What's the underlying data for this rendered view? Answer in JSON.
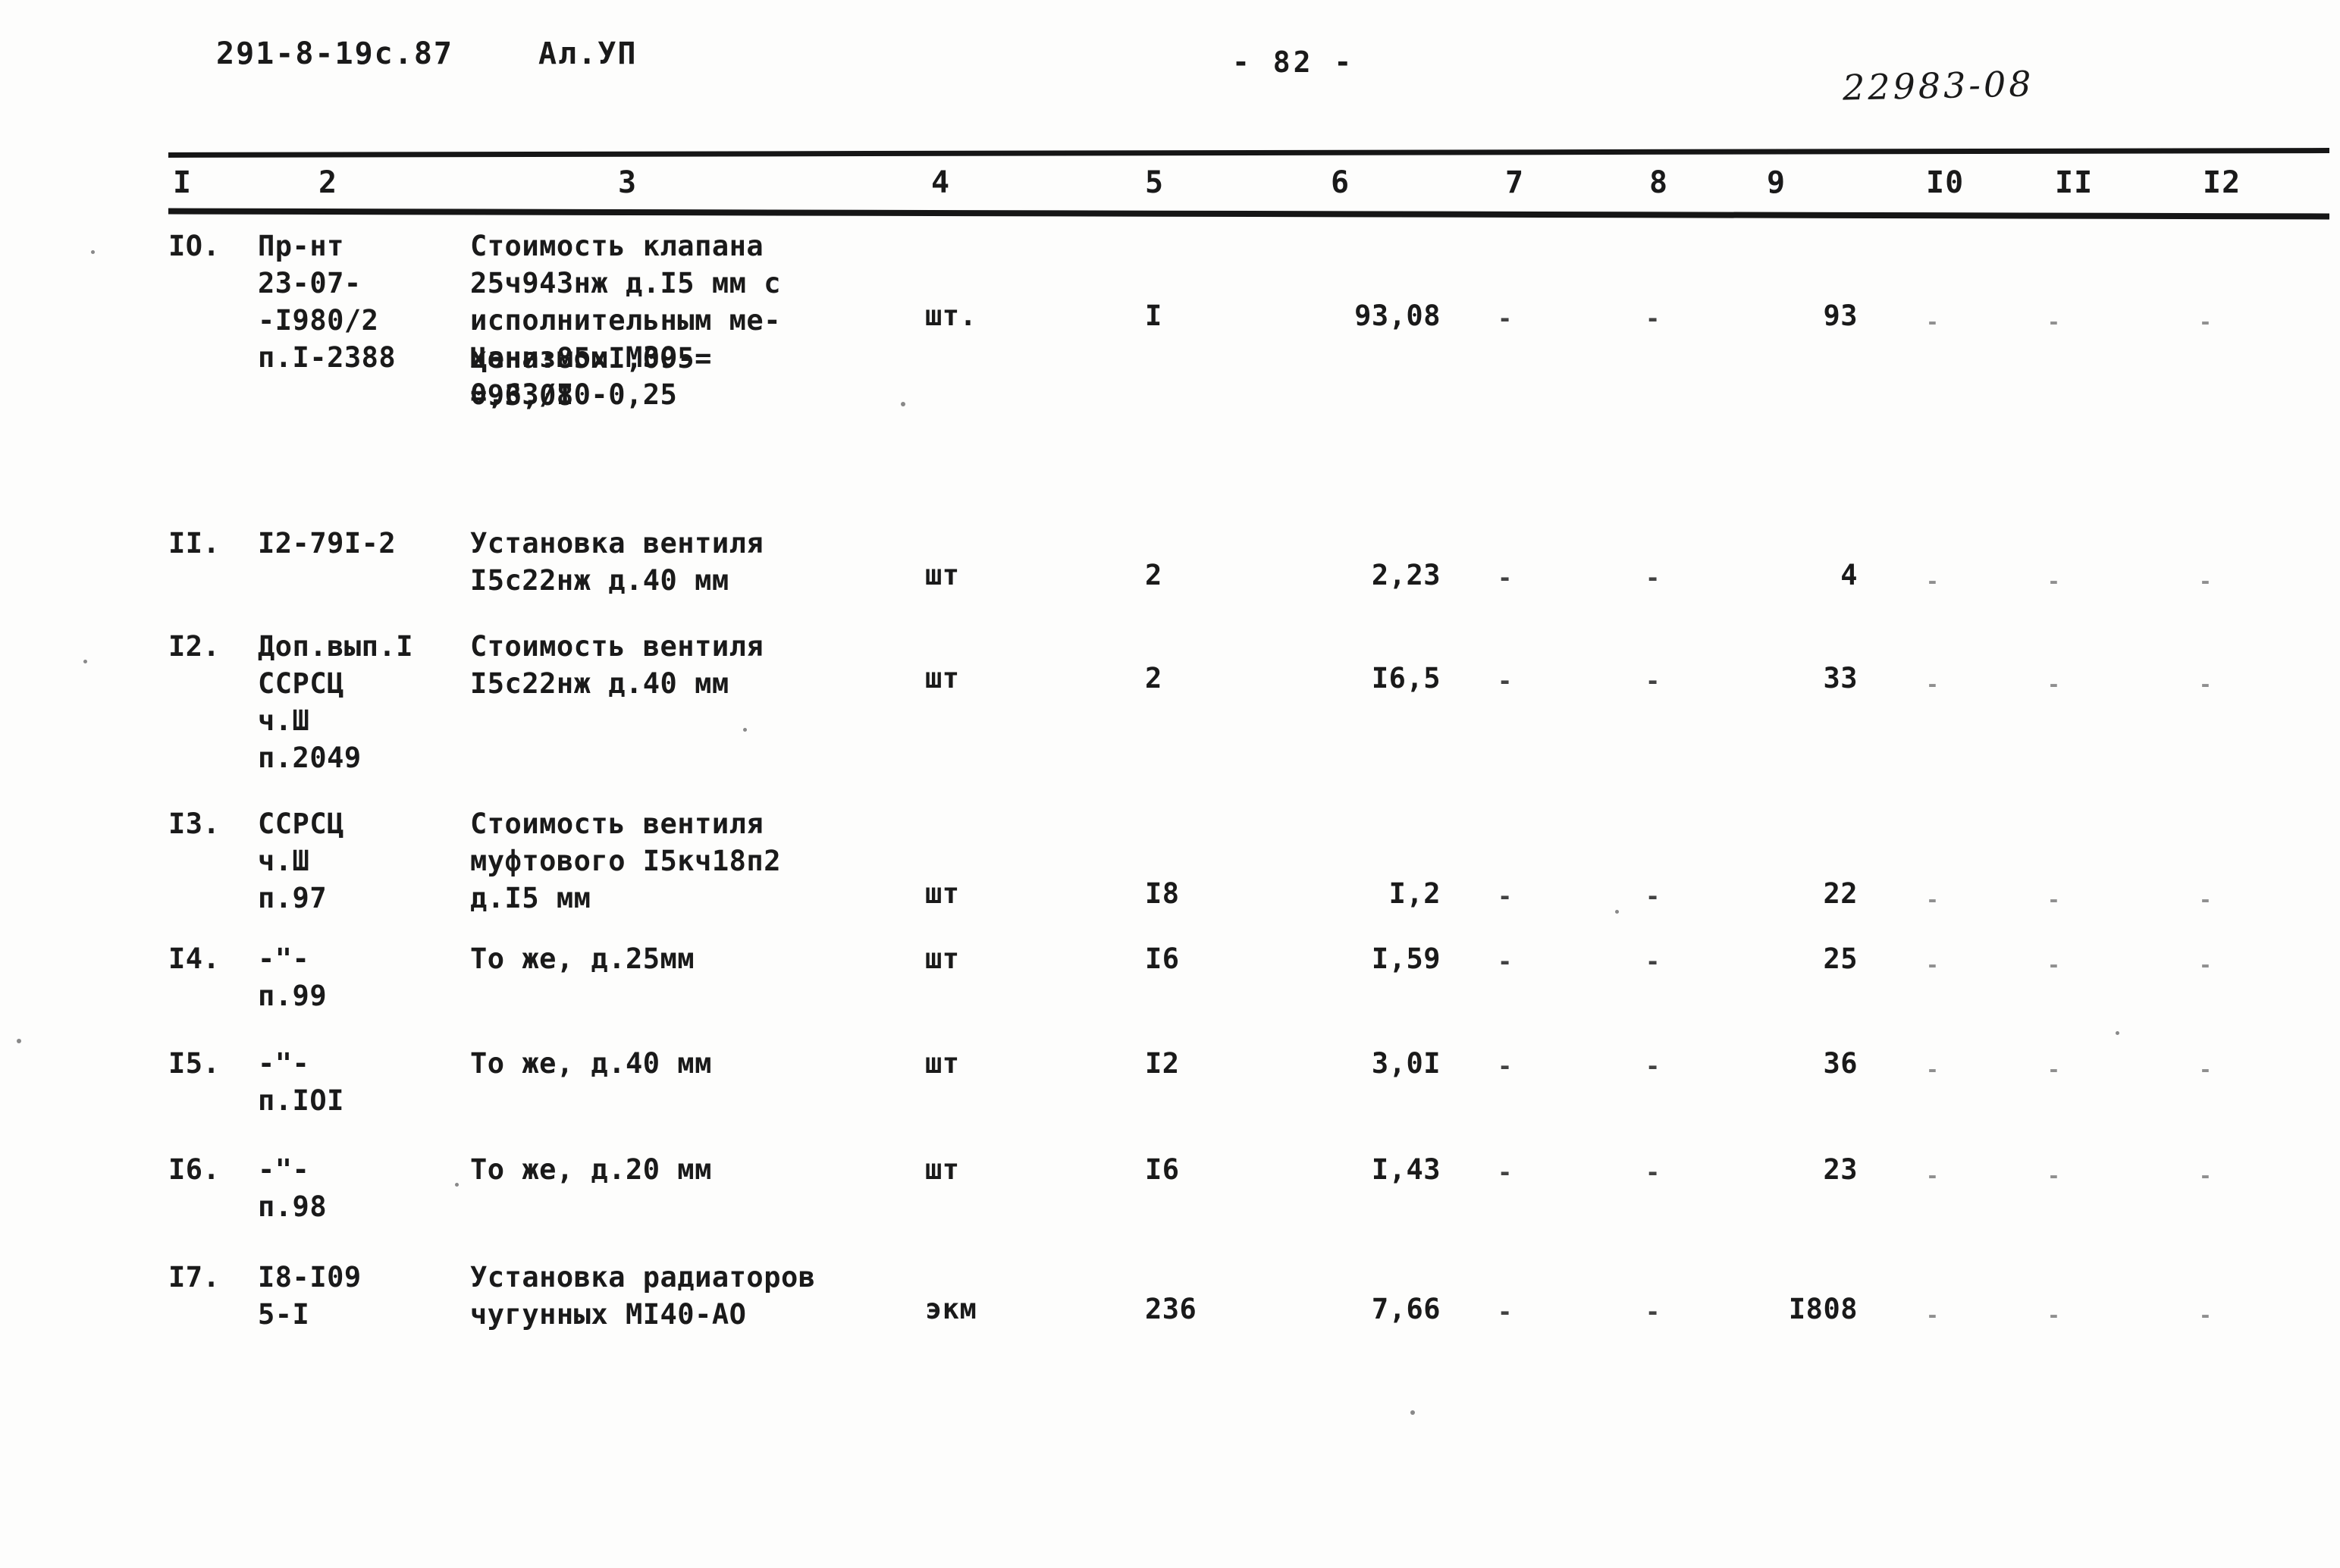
{
  "header": {
    "doc_code": "291-8-19с.87",
    "album_code": "Ал.УП",
    "page_number": "- 82 -",
    "stamp_number": "22983-08"
  },
  "table": {
    "column_headers": [
      "I",
      "2",
      "3",
      "4",
      "5",
      "6",
      "7",
      "8",
      "9",
      "I0",
      "II",
      "I2"
    ],
    "rows": [
      {
        "num": "IО.",
        "code": "Пр-нт\n23-07-\n-I980/2\nп.I-2388",
        "description": "Стоимость клапана\n25ч943нж д.I5 мм с\nисполнительным ме-\nханизмом МЗО-\n0,63/I0-0,25",
        "description2": "Цена:85хI,095=\n=93,08",
        "unit": "шт.",
        "qty": "I",
        "price": "93,08",
        "col7": "-",
        "col8": "-",
        "total": "93",
        "col10": "-",
        "col11": "-",
        "col12": "-"
      },
      {
        "num": "II.",
        "code": "I2-79I-2",
        "description": "Установка вентиля\nI5с22нж д.40 мм",
        "description2": "",
        "unit": "шт",
        "qty": "2",
        "price": "2,23",
        "col7": "-",
        "col8": "-",
        "total": "4",
        "col10": "-",
        "col11": "-",
        "col12": "-"
      },
      {
        "num": "I2.",
        "code": "Доп.вып.I\nССРСЦ\nч.Ш\nп.2049",
        "description": "Стоимость вентиля\nI5с22нж д.40 мм",
        "description2": "",
        "unit": "шт",
        "qty": "2",
        "price": "I6,5",
        "col7": "-",
        "col8": "-",
        "total": "33",
        "col10": "-",
        "col11": "-",
        "col12": "-"
      },
      {
        "num": "I3.",
        "code": "ССРСЦ\nч.Ш\nп.97",
        "description": "Стоимость вентиля\nмуфтового I5кч18п2\nд.I5 мм",
        "description2": "",
        "unit": "шт",
        "qty": "I8",
        "price": "I,2",
        "col7": "-",
        "col8": "-",
        "total": "22",
        "col10": "-",
        "col11": "-",
        "col12": "-"
      },
      {
        "num": "I4.",
        "code": "-\"-\nп.99",
        "description": "То же, д.25мм",
        "description2": "",
        "unit": "шт",
        "qty": "I6",
        "price": "I,59",
        "col7": "-",
        "col8": "-",
        "total": "25",
        "col10": "-",
        "col11": "-",
        "col12": "-"
      },
      {
        "num": "I5.",
        "code": "-\"-\nп.IОI",
        "description": "То же, д.40 мм",
        "description2": "",
        "unit": "шт",
        "qty": "I2",
        "price": "3,0I",
        "col7": "-",
        "col8": "-",
        "total": "36",
        "col10": "-",
        "col11": "-",
        "col12": "-"
      },
      {
        "num": "I6.",
        "code": "-\"-\nп.98",
        "description": "То же, д.20 мм",
        "description2": "",
        "unit": "шт",
        "qty": "I6",
        "price": "I,43",
        "col7": "-",
        "col8": "-",
        "total": "23",
        "col10": "-",
        "col11": "-",
        "col12": "-"
      },
      {
        "num": "I7.",
        "code": "I8-I09\n5-I",
        "description": "Установка радиаторов\nчугунных МI40-АО",
        "description2": "",
        "unit": "экм",
        "qty": "236",
        "price": "7,66",
        "col7": "-",
        "col8": "-",
        "total": "I808",
        "col10": "-",
        "col11": "-",
        "col12": "-"
      }
    ]
  }
}
